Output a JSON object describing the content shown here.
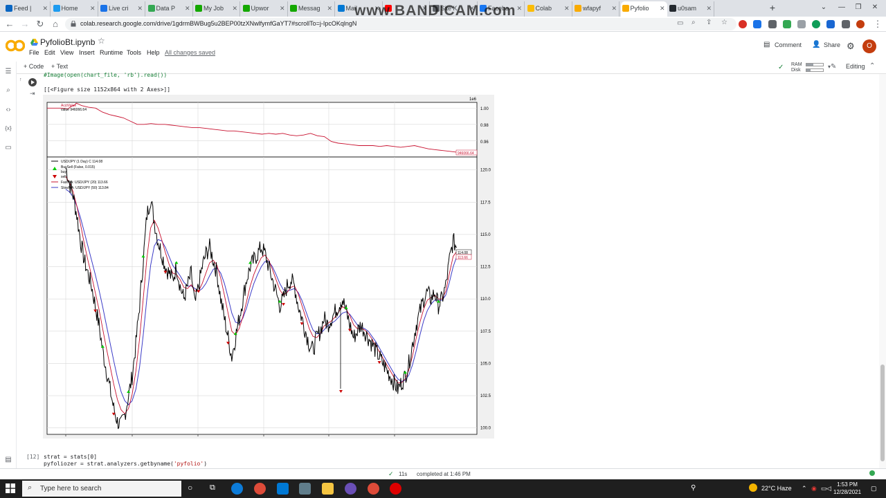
{
  "browser": {
    "tabs": [
      {
        "label": "Feed |",
        "color": "#0a66c2"
      },
      {
        "label": "Home",
        "color": "#1d9bf0"
      },
      {
        "label": "Live cri",
        "color": "#1a73e8"
      },
      {
        "label": "Data P",
        "color": "#34a853"
      },
      {
        "label": "My Job",
        "color": "#14a800"
      },
      {
        "label": "Upwor",
        "color": "#14a800"
      },
      {
        "label": "Messag",
        "color": "#14a800"
      },
      {
        "label": "Mail",
        "color": "#0078d4"
      },
      {
        "label": "",
        "color": "#ff0000"
      },
      {
        "label": "Site K",
        "color": "#5f6368"
      },
      {
        "label": "Facebo",
        "color": "#1877f2"
      },
      {
        "label": "Colab",
        "color": "#fbbc04"
      },
      {
        "label": "wfapyf",
        "color": "#f9ab00"
      },
      {
        "label": "Pyfolio",
        "color": "#f9ab00"
      },
      {
        "label": "u0sam",
        "color": "#24292f"
      }
    ],
    "active_tab_index": 13,
    "watermark": "www.BANDICAM.com",
    "url": "colab.research.google.com/drive/1gdrmBWBug5u2BEP00tzXNwlfymfGaYT7#scrollTo=j-IpcOKqlngN",
    "new_tab_label": "+"
  },
  "colab": {
    "title": "PyfolioBt.ipynb",
    "menu": [
      "File",
      "Edit",
      "View",
      "Insert",
      "Runtime",
      "Tools",
      "Help"
    ],
    "saved_status": "All changes saved",
    "comment_label": "Comment",
    "share_label": "Share",
    "avatar_initial": "O",
    "toolbar": {
      "code_label": "+ Code",
      "text_label": "+ Text",
      "ram_label": "RAM",
      "disk_label": "Disk",
      "editing_label": "Editing"
    }
  },
  "cells": {
    "prev_code_line": "#Image(open(chart_file, 'rb').read())",
    "output_text": "[[<Figure size 1152x864 with 2 Axes>]]",
    "next_cell_number": "[12]",
    "next_line1": "strat = stats[0]",
    "next_line2_prefix": "pyfoliozer = strat.analyzers.getbyname(",
    "next_line2_string": "'pyfolio'",
    "next_line2_suffix": ")"
  },
  "status": {
    "elapsed": "11s",
    "completed": "completed at 1:46 PM"
  },
  "taskbar": {
    "search_placeholder": "Type here to search",
    "weather": "22°C  Haze",
    "time": "1:53 PM",
    "date": "12/28/2021"
  },
  "chart_data": [
    {
      "type": "line",
      "title": "",
      "exponent_label": "1e6",
      "legend": [
        "AcctValue",
        "value 946066.64"
      ],
      "yticks": [
        "1.00",
        "0.98",
        "0.96"
      ],
      "last_value_label": "946066.64",
      "series": [
        {
          "name": "value",
          "color": "#c8102e",
          "x": [
            0,
            20,
            30,
            35,
            40,
            42,
            45,
            50,
            60,
            70,
            80,
            90,
            100,
            110,
            120,
            130,
            140,
            150,
            160,
            170,
            180,
            190,
            200,
            210,
            220,
            230,
            240,
            250,
            260,
            270,
            280,
            290,
            300,
            310,
            320,
            330,
            340,
            350,
            360,
            370,
            380,
            390,
            400,
            410,
            420,
            430,
            440,
            450,
            460,
            470,
            480,
            490,
            500,
            510,
            520,
            530,
            540,
            550,
            560,
            570,
            580,
            590,
            600,
            610,
            620
          ],
          "values": [
            1.0,
            1.0,
            0.999,
            1.002,
            1.004,
            1.006,
            1.005,
            1.003,
            1.001,
            1.0,
            0.995,
            0.992,
            0.99,
            0.988,
            0.984,
            0.98,
            0.98,
            0.981,
            0.98,
            0.98,
            0.979,
            0.978,
            0.977,
            0.976,
            0.976,
            0.975,
            0.974,
            0.973,
            0.972,
            0.972,
            0.971,
            0.97,
            0.969,
            0.968,
            0.969,
            0.968,
            0.969,
            0.967,
            0.966,
            0.967,
            0.969,
            0.966,
            0.965,
            0.959,
            0.957,
            0.956,
            0.955,
            0.954,
            0.954,
            0.954,
            0.953,
            0.954,
            0.953,
            0.952,
            0.953,
            0.954,
            0.952,
            0.95,
            0.949,
            0.948,
            0.947,
            0.946,
            0.946,
            0.946,
            0.946
          ]
        }
      ]
    },
    {
      "type": "line",
      "title": "",
      "legend": [
        "USD/JPY (1 Day) C 114.08",
        "BuySell (False, 0.015)",
        "buy",
        "sell",
        "FastMA: USD/JPY (20) 113.66",
        "SlowMA: USD/JPY (50) 113.84"
      ],
      "yticks": [
        "120.0",
        "117.5",
        "115.0",
        "112.5",
        "110.0",
        "107.5",
        "105.0",
        "102.5",
        "100.0"
      ],
      "ylim": [
        99.5,
        121.0
      ],
      "last_price_labels": [
        "114.08",
        "113.66"
      ],
      "series": [
        {
          "name": "USD/JPY",
          "color": "#000000",
          "values": [
            120.2,
            119.0,
            118.0,
            116.5,
            114.5,
            113.0,
            112.0,
            111.0,
            109.5,
            108.0,
            106.0,
            104.5,
            103.0,
            101.5,
            100.5,
            100.2,
            101.0,
            102.5,
            104.0,
            106.5,
            109.5,
            113.0,
            116.5,
            117.8,
            116.0,
            114.5,
            113.5,
            112.5,
            112.0,
            111.5,
            112.5,
            111.0,
            110.0,
            111.0,
            112.0,
            109.5,
            111.0,
            112.5,
            113.5,
            114.0,
            113.0,
            112.0,
            110.0,
            108.5,
            107.0,
            105.5,
            107.0,
            108.5,
            110.0,
            111.5,
            112.5,
            113.0,
            113.5,
            114.0,
            113.5,
            112.5,
            111.5,
            110.5,
            109.5,
            110.0,
            111.0,
            111.5,
            111.0,
            109.5,
            108.5,
            107.5,
            106.5,
            106.0,
            107.0,
            107.5,
            108.5,
            108.0,
            108.5,
            109.0,
            109.5,
            110.0,
            109.0,
            108.0,
            107.0,
            107.5,
            108.0,
            107.5,
            107.0,
            106.5,
            106.0,
            105.5,
            105.0,
            104.5,
            104.0,
            103.5,
            103.0,
            103.5,
            104.0,
            105.0,
            106.5,
            108.0,
            109.0,
            110.0,
            110.5,
            110.0,
            110.5,
            109.5,
            110.0,
            111.0,
            113.0,
            114.5,
            114.0
          ]
        },
        {
          "name": "FastMA",
          "color": "#c8102e",
          "values": [
            119.5,
            119.0,
            118.3,
            117.2,
            115.8,
            114.3,
            113.0,
            111.8,
            110.5,
            109.2,
            107.7,
            106.2,
            104.8,
            103.4,
            102.2,
            101.4,
            101.1,
            101.5,
            102.6,
            104.4,
            106.9,
            110.0,
            113.2,
            115.5,
            116.1,
            115.5,
            114.6,
            113.6,
            112.7,
            112.0,
            111.9,
            111.5,
            110.9,
            110.8,
            111.1,
            110.6,
            110.6,
            111.2,
            112.0,
            112.8,
            113.0,
            112.6,
            111.6,
            110.3,
            108.9,
            107.5,
            107.2,
            107.7,
            108.6,
            109.8,
            111.0,
            111.9,
            112.6,
            113.2,
            113.4,
            113.0,
            112.3,
            111.5,
            110.7,
            110.3,
            110.5,
            110.9,
            111.0,
            110.4,
            109.5,
            108.6,
            107.7,
            107.1,
            107.0,
            107.3,
            107.9,
            108.1,
            108.3,
            108.6,
            109.0,
            109.4,
            109.2,
            108.7,
            108.0,
            107.7,
            107.7,
            107.6,
            107.3,
            106.9,
            106.4,
            105.9,
            105.4,
            104.9,
            104.4,
            103.9,
            103.5,
            103.5,
            103.8,
            104.5,
            105.6,
            107.0,
            108.2,
            109.2,
            109.9,
            110.1,
            110.3,
            110.0,
            110.0,
            110.6,
            112.0,
            113.3,
            113.7
          ]
        },
        {
          "name": "SlowMA",
          "color": "#3b3bc7",
          "values": [
            118.5,
            118.3,
            117.9,
            117.2,
            116.3,
            115.2,
            114.1,
            113.0,
            111.9,
            110.7,
            109.4,
            108.0,
            106.6,
            105.2,
            103.9,
            102.8,
            102.1,
            101.8,
            102.1,
            103.0,
            104.7,
            107.2,
            110.1,
            112.6,
            114.1,
            114.6,
            114.5,
            114.0,
            113.3,
            112.6,
            112.2,
            111.8,
            111.3,
            111.0,
            111.0,
            110.8,
            110.6,
            110.8,
            111.2,
            111.8,
            112.3,
            112.4,
            112.0,
            111.2,
            110.1,
            108.9,
            108.2,
            108.1,
            108.5,
            109.3,
            110.3,
            111.2,
            111.9,
            112.5,
            112.9,
            112.9,
            112.5,
            111.9,
            111.2,
            110.7,
            110.6,
            110.7,
            110.8,
            110.5,
            109.9,
            109.1,
            108.3,
            107.6,
            107.3,
            107.3,
            107.6,
            107.9,
            108.1,
            108.3,
            108.6,
            108.9,
            109.0,
            108.8,
            108.4,
            108.0,
            107.8,
            107.7,
            107.5,
            107.1,
            106.7,
            106.2,
            105.7,
            105.2,
            104.7,
            104.2,
            103.8,
            103.6,
            103.7,
            104.1,
            104.9,
            106.0,
            107.2,
            108.3,
            109.1,
            109.6,
            109.9,
            109.9,
            109.9,
            110.3,
            111.3,
            112.5,
            113.3
          ]
        }
      ]
    }
  ]
}
